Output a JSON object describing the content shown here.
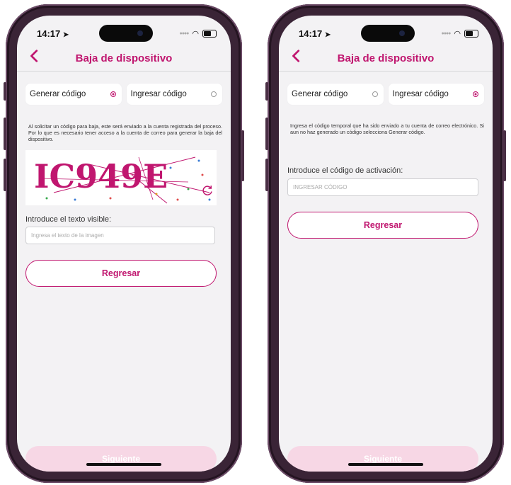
{
  "status": {
    "time": "14:17"
  },
  "accent_color": "#c0166f",
  "screens": [
    {
      "nav_title": "Baja de dispositivo",
      "options": [
        {
          "label": "Generar código",
          "selected": true
        },
        {
          "label": "Ingresar código",
          "selected": false
        }
      ],
      "info": "Al solicitar un código para baja, este será enviado a la cuenta registrada del proceso. Por lo que es necesario tener acceso a la cuenta de correo para generar la baja del dispositivo.",
      "captcha_text": "IC949E",
      "field_label": "Introduce el texto visible:",
      "input_placeholder": "Ingresa el texto de la imagen",
      "back_button": "Regresar",
      "next_button": "Siguiente"
    },
    {
      "nav_title": "Baja de dispositivo",
      "options": [
        {
          "label": "Generar código",
          "selected": false
        },
        {
          "label": "Ingresar código",
          "selected": true
        }
      ],
      "info": "Ingresa el código temporal que ha sido enviado a tu cuenta de correo electrónico. Si aun no haz generado un código selecciona Generar código.",
      "field_label": "Introduce el código de activación:",
      "input_placeholder": "INGRESAR CÓDIGO",
      "back_button": "Regresar",
      "next_button": "Siguiente"
    }
  ]
}
